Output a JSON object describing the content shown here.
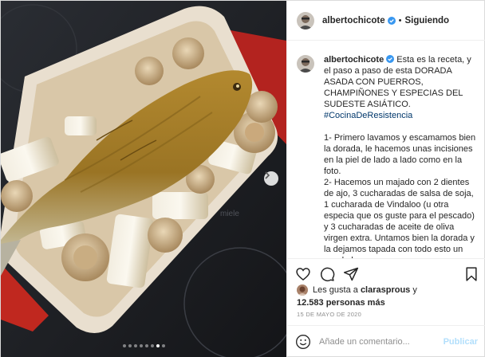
{
  "post": {
    "username": "albertochicote",
    "follow_status": "Siguiendo",
    "separator": "•",
    "caption": {
      "intro": "Esta es la receta, y el paso a paso de esta DORADA ASADA CON PUERROS, CHAMPIÑONES Y ESPECIAS DEL SUDESTE ASIÁTICO.",
      "hashtag": "#CocinaDeResistencia",
      "step1": "1- Primero lavamos y escamamos bien la dorada, le hacemos unas incisiones en la piel de lado a lado como en la foto.",
      "step2": "2- Hacemos un majado con 2 dientes de ajo, 3 cucharadas de salsa de soja, 1 cucharada de Vindaloo (u otra especia que os guste para el pescado) y 3 cucharadas de aceite de oliva virgen extra. Untamos bien la dorada y la dejamos tapada con todo esto un par de horas."
    },
    "likes": {
      "prefix": "Les gusta a",
      "user": "clarasprous",
      "conjunction": "y",
      "count": "12.583 personas más"
    },
    "date": "15 DE MAYO DE 2020",
    "comment_placeholder": "Añade un comentario...",
    "publish_label": "Publicar"
  },
  "carousel": {
    "total": 8,
    "active_index": 6
  },
  "icons": [
    "verified-badge-icon",
    "heart-icon",
    "comment-icon",
    "share-icon",
    "bookmark-icon",
    "emoji-icon",
    "chevron-right-icon"
  ],
  "colors": {
    "link": "#00376b",
    "verified": "#3897f0",
    "publish_disabled": "#b2dffc",
    "muted": "#8e8e8e"
  }
}
